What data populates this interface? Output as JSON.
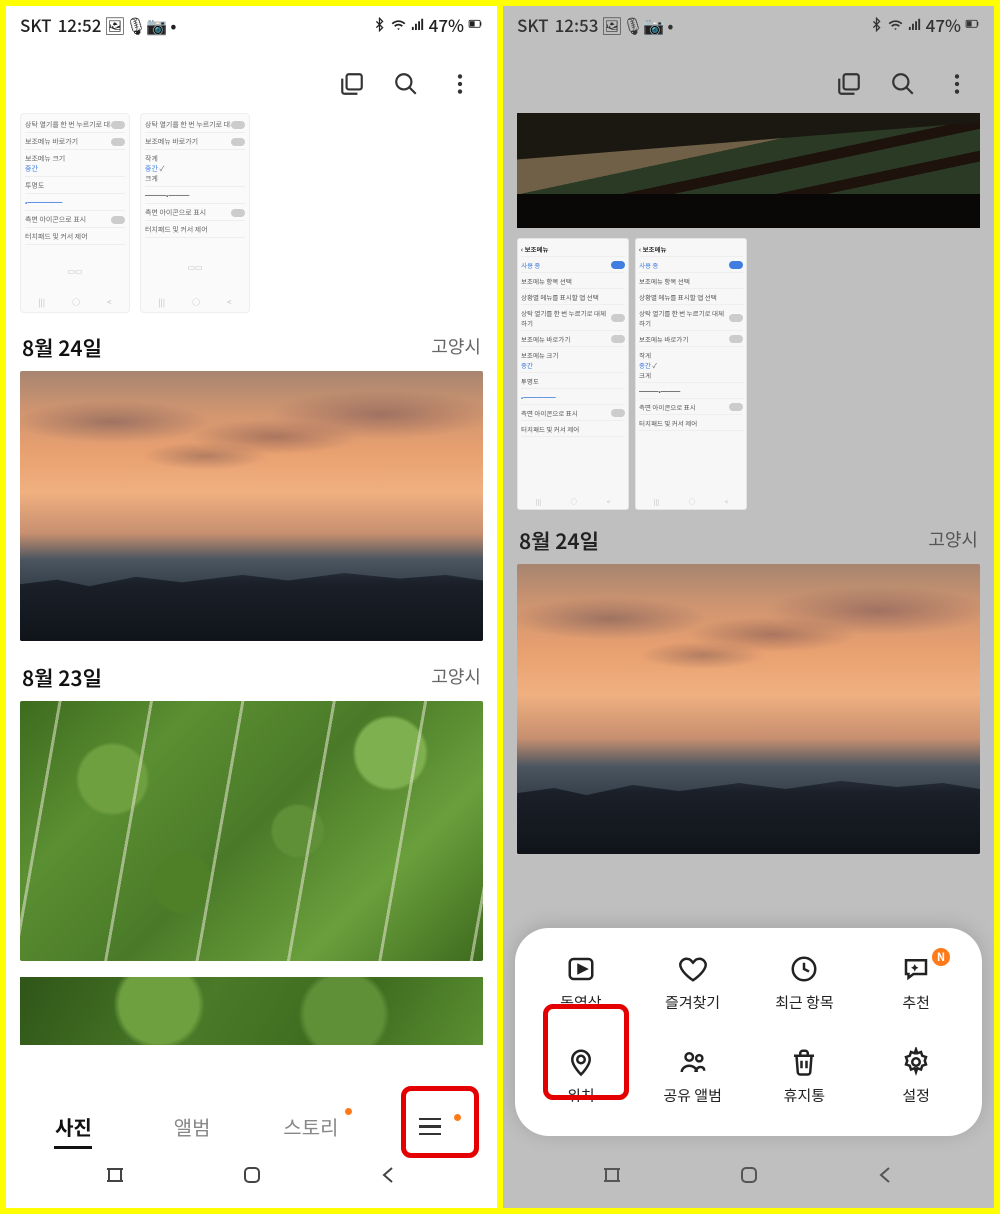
{
  "left": {
    "status": {
      "carrier": "SKT",
      "time": "12:52",
      "battery": "47%"
    },
    "dates": [
      {
        "label": "8월 24일",
        "location": "고양시"
      },
      {
        "label": "8월 23일",
        "location": "고양시"
      }
    ],
    "tabs": {
      "photos": "사진",
      "albums": "앨범",
      "stories": "스토리"
    },
    "settings_thumb": {
      "row1": "상탁 열기를 한 번 누르기로 대체하기",
      "row2": "보조메뉴 바로가기",
      "row3": "보조메뉴 크기",
      "row3v": "중간",
      "row4": "투명도",
      "row5": "측면 아이콘으로 표시",
      "row6": "터치패드 및 커서 제어",
      "opt1": "작게",
      "opt2": "중간",
      "opt3": "크게"
    }
  },
  "right": {
    "status": {
      "carrier": "SKT",
      "time": "12:53",
      "battery": "47%"
    },
    "date": {
      "label": "8월 24일",
      "location": "고양시"
    },
    "sheet": {
      "videos": "동영상",
      "favorites": "즐겨찾기",
      "recent": "최근 항목",
      "suggestions": "추천",
      "location": "위치",
      "shared": "공유 앨범",
      "trash": "휴지통",
      "settings": "설정",
      "badge": "N"
    },
    "settings_thumb": {
      "title": "보조메뉴",
      "using": "사용 중",
      "r1": "보조메뉴 항목 선택",
      "r2": "상황별 메뉴를 표시할 앱 선택",
      "r3": "상탁 열기를 한 번 누르기로 대체하기",
      "r4": "보조메뉴 바로가기",
      "r5": "보조메뉴 크기",
      "r5v": "중간",
      "r6": "투명도",
      "r7": "측면 아이콘으로 표시",
      "r8": "터치패드 및 커서 제어",
      "opt1": "작게",
      "opt2": "중간",
      "opt3": "크게"
    }
  }
}
